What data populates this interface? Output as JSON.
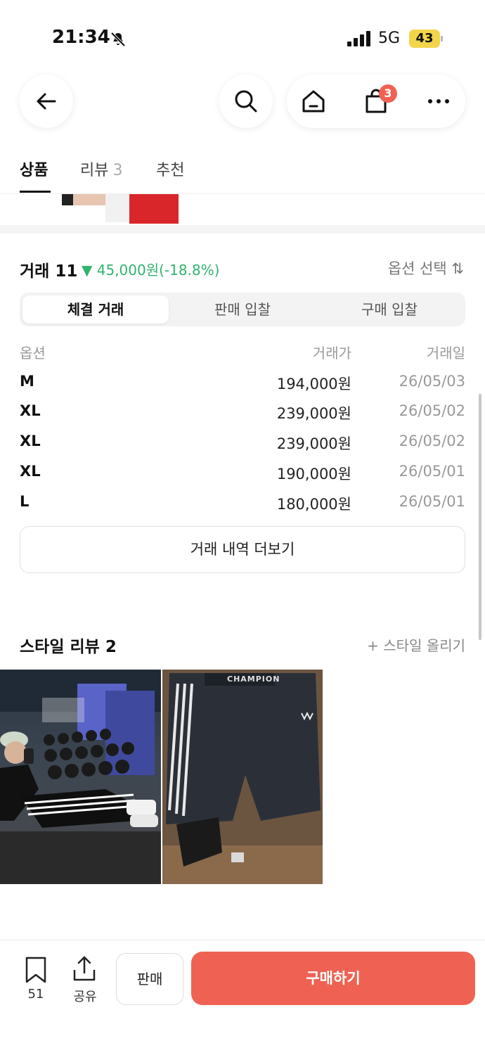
{
  "status_bar": {
    "time": "21:34",
    "network": "5G",
    "battery": "43"
  },
  "nav": {
    "cart_count": "3"
  },
  "tabs": [
    {
      "label": "상품",
      "count": ""
    },
    {
      "label": "리뷰",
      "count": "3"
    },
    {
      "label": "추천",
      "count": ""
    }
  ],
  "trade": {
    "title": "거래 11",
    "change": "▼ 45,000원(-18.8%)",
    "option_select": "옵션 선택 ⇅",
    "segments": [
      "체결 거래",
      "판매 입찰",
      "구매 입찰"
    ],
    "columns": [
      "옵션",
      "거래가",
      "거래일"
    ],
    "rows": [
      {
        "option": "M",
        "price": "194,000원",
        "date": "26/05/03"
      },
      {
        "option": "XL",
        "price": "239,000원",
        "date": "26/05/02"
      },
      {
        "option": "XL",
        "price": "239,000원",
        "date": "26/05/02"
      },
      {
        "option": "XL",
        "price": "190,000원",
        "date": "26/05/01"
      },
      {
        "option": "L",
        "price": "180,000원",
        "date": "26/05/01"
      }
    ],
    "more_label": "거래 내역 더보기"
  },
  "style_review": {
    "title": "스타일 리뷰 2",
    "upload_label": "+ 스타일 올리기",
    "photo_logo": "CHAMPION"
  },
  "bottom_bar": {
    "bookmark_count": "51",
    "share_label": "공유",
    "sell_label": "판매",
    "buy_label": "구매하기"
  },
  "colors": {
    "accent": "#ef6253",
    "price_down": "#31b46e",
    "battery": "#f2d54b"
  }
}
